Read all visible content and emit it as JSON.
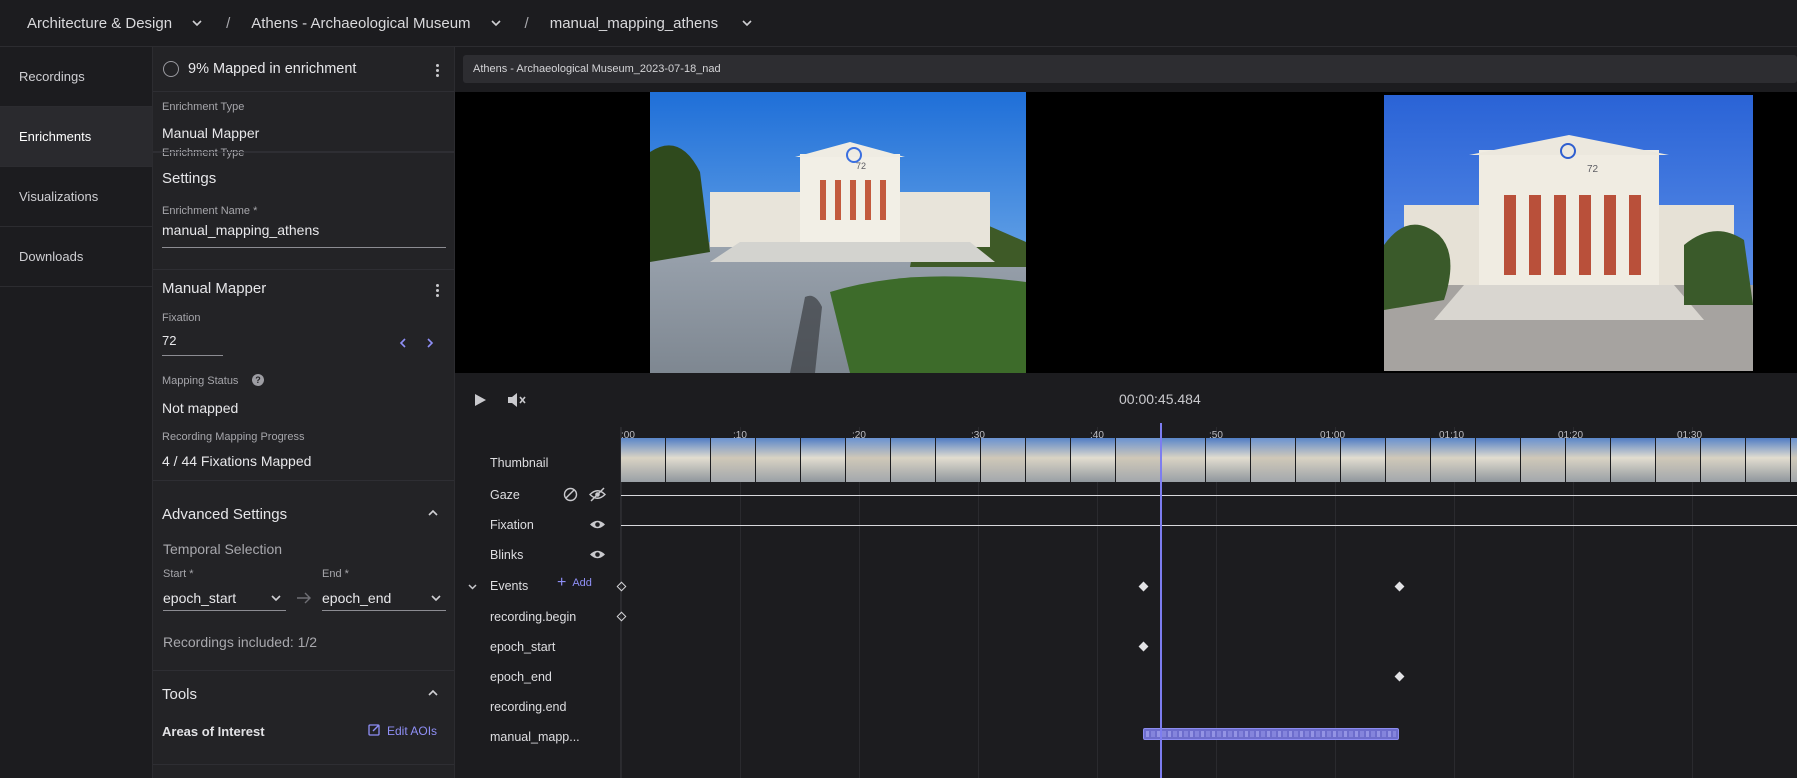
{
  "topbar": {
    "workspace": "Architecture & Design",
    "project": "Athens - Archaeological Museum",
    "enrichment": "manual_mapping_athens",
    "separator": "/"
  },
  "nav": {
    "items": [
      {
        "label": "Recordings",
        "active": false
      },
      {
        "label": "Enrichments",
        "active": true
      },
      {
        "label": "Visualizations",
        "active": false
      },
      {
        "label": "Downloads",
        "active": false
      }
    ]
  },
  "panel": {
    "status": "9% Mapped in enrichment",
    "enrichment_type_label": "Enrichment Type",
    "enrichment_type": "Manual Mapper",
    "settings_header": "Settings",
    "enrichment_name_label": "Enrichment Name *",
    "enrichment_name": "manual_mapping_athens",
    "mapper_header": "Manual Mapper",
    "fixation_label": "Fixation",
    "fixation_value": "72",
    "mapping_status_label": "Mapping Status",
    "mapping_status": "Not mapped",
    "progress_label": "Recording Mapping Progress",
    "progress_value": "4 / 44 Fixations Mapped",
    "advanced_header": "Advanced Settings",
    "temporal_label": "Temporal Selection",
    "start_label": "Start *",
    "start_value": "epoch_start",
    "end_label": "End *",
    "end_value": "epoch_end",
    "recordings_included": "Recordings included: 1/2",
    "tools_header": "Tools",
    "aoi_label": "Areas of Interest",
    "edit_aois": "Edit AOIs"
  },
  "player": {
    "recording_name": "Athens - Archaeological Museum_2023-07-18_nad",
    "timecode": "00:00:45.484",
    "fixation_marker_label": "72"
  },
  "timeline": {
    "ticks": [
      ":00",
      ":10",
      ":20",
      ":30",
      ":40",
      ":50",
      "01:00",
      "01:10",
      "01:20",
      "01:30"
    ],
    "tracks": {
      "thumbnail": "Thumbnail",
      "gaze": "Gaze",
      "fixation": "Fixation",
      "blinks": "Blinks",
      "events": "Events",
      "add": "Add",
      "recording_begin": "recording.begin",
      "epoch_start": "epoch_start",
      "epoch_end": "epoch_end",
      "recording_end": "recording.end",
      "manual_mapping": "manual_mapp..."
    }
  },
  "colors": {
    "accent": "#7d7df0",
    "background": "#1c1c1f",
    "panel": "#232326"
  }
}
